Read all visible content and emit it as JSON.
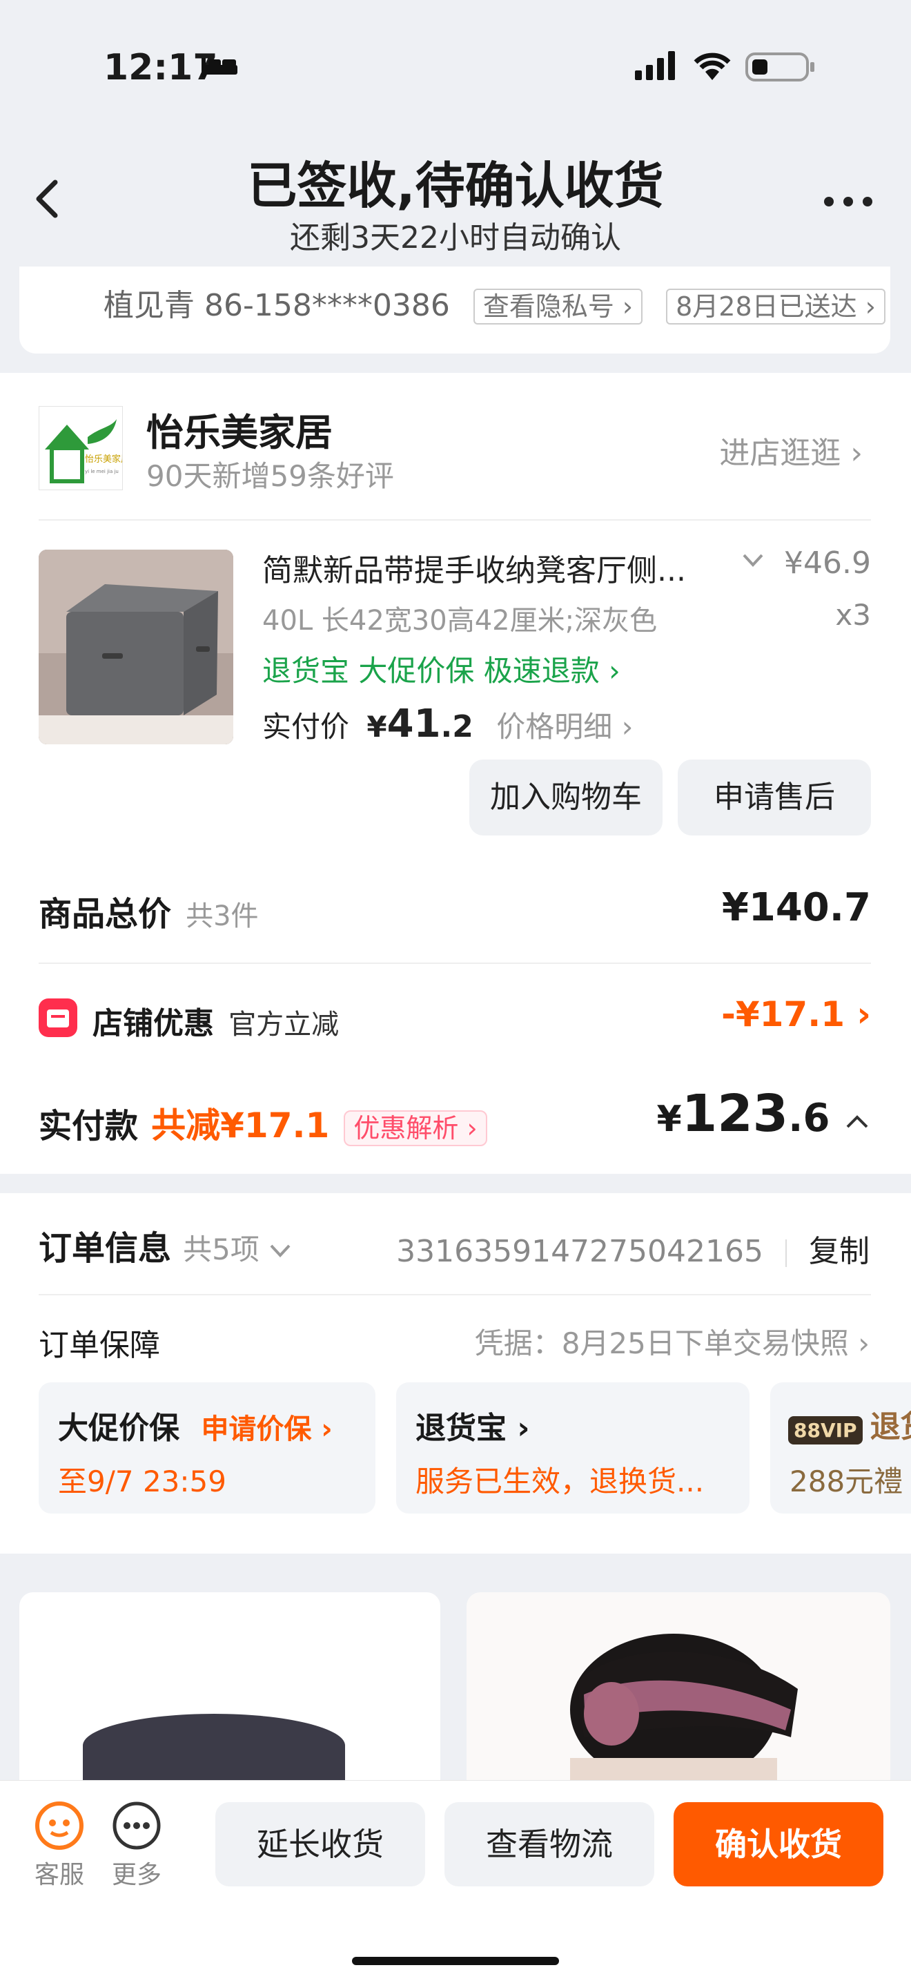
{
  "status_bar": {
    "time": "12:17"
  },
  "nav": {
    "title": "已签收,待确认收货",
    "subtitle": "还剩3天22小时自动确认"
  },
  "address": {
    "receiver": "植见青 86-158****0386",
    "privacy_btn": "查看隐私号 ›",
    "delivery_btn": "8月28日已送达 ›"
  },
  "shop": {
    "name": "怡乐美家居",
    "subtitle": "90天新增59条好评",
    "link": "进店逛逛 ›",
    "logo_text": "怡乐美家居",
    "logo_sub": "yi le mei jia ju"
  },
  "product": {
    "title": "简默新品带提手收纳凳客厅侧...",
    "price": "¥46.9",
    "spec": "40L 长42宽30高42厘米;深灰色",
    "qty": "x3",
    "tags": "退货宝  大促价保  极速退款 ›",
    "paid_label": "实付价",
    "paid_currency": "¥",
    "paid_int": "41",
    "paid_dec": ".2",
    "price_detail": "价格明细 ›",
    "btn_cart": "加入购物车",
    "btn_aftersale": "申请售后"
  },
  "totals": {
    "goods_label": "商品总价",
    "goods_count": "共3件",
    "goods_value": "¥140.7",
    "shop_promo_label": "店铺优惠",
    "shop_promo_desc": "官方立减",
    "shop_promo_value": "-¥17.1 ›",
    "paid_label": "实付款",
    "paid_saving": "共减¥17.1",
    "promo_tag": "优惠解析 ›",
    "paid_currency": "¥",
    "paid_int": "123",
    "paid_dec": ".6"
  },
  "order_info": {
    "label": "订单信息",
    "count": "共5项",
    "order_no": "3316359147275042165",
    "copy": "复制",
    "guarantee_label": "订单保障",
    "guarantee_value": "凭据：8月25日下单交易快照 ›",
    "cards": [
      {
        "title": "大促价保",
        "action": "申请价保 ›",
        "sub": "至9/7 23:59"
      },
      {
        "title": "退货宝 ›",
        "sub": "服务已生效，退换货..."
      },
      {
        "badge": "88VIP",
        "title": "退货",
        "sub": "288元禮"
      }
    ]
  },
  "bottom_bar": {
    "service": "客服",
    "more": "更多",
    "extend": "延长收货",
    "logistics": "查看物流",
    "confirm": "确认收货"
  },
  "colors": {
    "accent": "#ff5a00",
    "green": "#1aa34a",
    "red": "#ff2e4d"
  }
}
